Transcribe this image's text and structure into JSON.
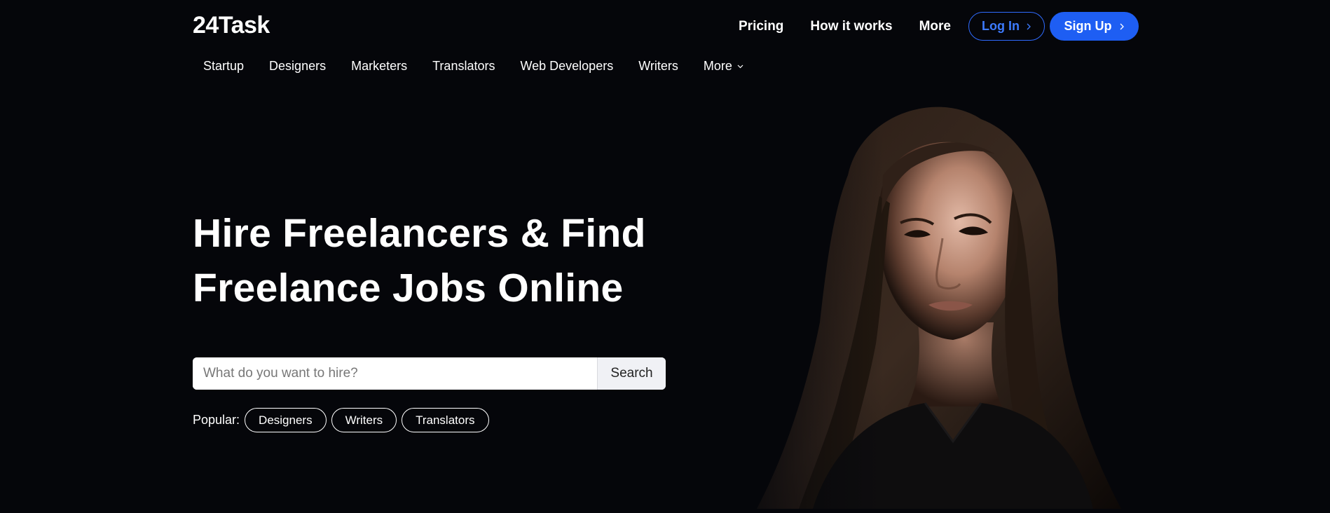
{
  "brand": {
    "logo": "24Task"
  },
  "topnav": {
    "links": [
      "Pricing",
      "How it works",
      "More"
    ],
    "login_label": "Log In",
    "signup_label": "Sign Up"
  },
  "categories": {
    "items": [
      "Startup",
      "Designers",
      "Marketers",
      "Translators",
      "Web Developers",
      "Writers"
    ],
    "more_label": "More"
  },
  "hero": {
    "title_line1": "Hire Freelancers & Find",
    "title_line2": "Freelance Jobs Online"
  },
  "search": {
    "placeholder": "What do you want to hire?",
    "value": "",
    "button_label": "Search"
  },
  "popular": {
    "label": "Popular:",
    "chips": [
      "Designers",
      "Writers",
      "Translators"
    ]
  },
  "colors": {
    "background": "#05060a",
    "accent": "#1e5ef3",
    "login_border": "#2f6bff"
  },
  "icons": [
    "chevron-right-icon",
    "chevron-down-icon"
  ]
}
